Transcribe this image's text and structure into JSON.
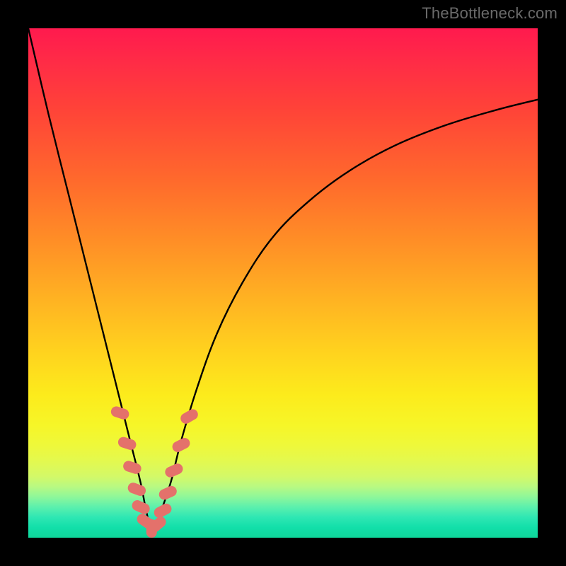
{
  "watermark": "TheBottleneck.com",
  "chart_data": {
    "type": "line",
    "title": "",
    "xlabel": "",
    "ylabel": "",
    "xlim": [
      0,
      100
    ],
    "ylim": [
      0,
      100
    ],
    "notch_x": 24,
    "series": [
      {
        "name": "curve",
        "x": [
          0,
          4,
          8,
          12,
          15,
          18,
          20,
          22,
          23,
          24,
          25,
          26,
          28,
          30,
          33,
          37,
          42,
          48,
          55,
          63,
          72,
          82,
          92,
          100
        ],
        "values": [
          100,
          83,
          67,
          51,
          39,
          27,
          19,
          11,
          6,
          2,
          2,
          5,
          11,
          19,
          29,
          40,
          50,
          59,
          66,
          72,
          77,
          81,
          84,
          86
        ]
      }
    ],
    "markers": {
      "name": "highlighted-points",
      "color": "#e4716b",
      "points": [
        {
          "x": 18.0,
          "y": 24.5,
          "rot": -72
        },
        {
          "x": 19.4,
          "y": 18.5,
          "rot": -72
        },
        {
          "x": 20.4,
          "y": 13.8,
          "rot": -72
        },
        {
          "x": 21.3,
          "y": 9.5,
          "rot": -70
        },
        {
          "x": 22.1,
          "y": 6.0,
          "rot": -66
        },
        {
          "x": 23.0,
          "y": 3.2,
          "rot": -55
        },
        {
          "x": 24.2,
          "y": 1.8,
          "rot": 0
        },
        {
          "x": 25.4,
          "y": 2.6,
          "rot": 50
        },
        {
          "x": 26.4,
          "y": 5.3,
          "rot": 62
        },
        {
          "x": 27.4,
          "y": 8.8,
          "rot": 66
        },
        {
          "x": 28.6,
          "y": 13.2,
          "rot": 66
        },
        {
          "x": 30.0,
          "y": 18.2,
          "rot": 63
        },
        {
          "x": 31.6,
          "y": 23.8,
          "rot": 60
        }
      ]
    }
  }
}
